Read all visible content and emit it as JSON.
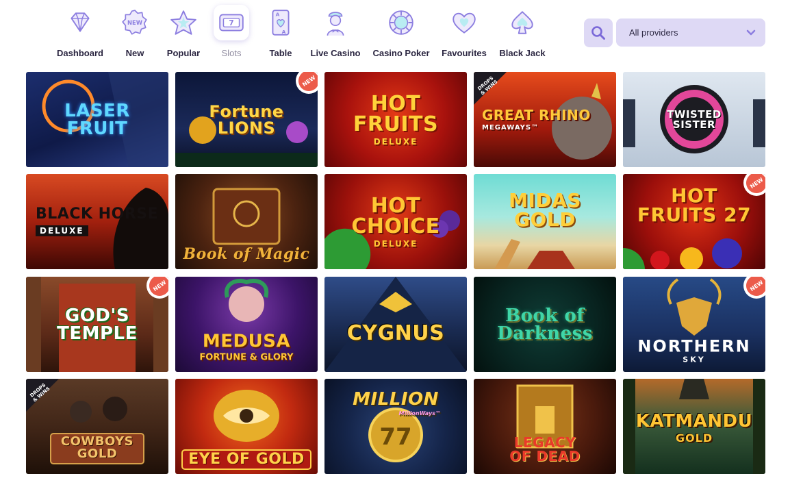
{
  "nav": {
    "items": [
      {
        "label": "Dashboard",
        "icon": "diamond-icon"
      },
      {
        "label": "New",
        "icon": "new-badge-icon"
      },
      {
        "label": "Popular",
        "icon": "star-icon"
      },
      {
        "label": "Slots",
        "icon": "slot-machine-icon",
        "active": true
      },
      {
        "label": "Table",
        "icon": "playing-card-icon"
      },
      {
        "label": "Live Casino",
        "icon": "dealer-icon"
      },
      {
        "label": "Casino Poker",
        "icon": "poker-chip-icon"
      },
      {
        "label": "Favourites",
        "icon": "heart-icon"
      },
      {
        "label": "Black Jack",
        "icon": "spade-icon"
      }
    ]
  },
  "filters": {
    "search_icon": "search-icon",
    "provider": "All providers",
    "provider_icon": "chevron-down-icon"
  },
  "badges": {
    "new": "NEW",
    "drops_wins": "DROPS & WINS"
  },
  "colors": {
    "accent": "#ded9f5",
    "icon_purple": "#8c7ee0",
    "badge_red": "#ec5b4a"
  },
  "games": [
    {
      "title": "LASER FRUIT",
      "subtitle": ""
    },
    {
      "title": "Fortune LIONS",
      "subtitle": "",
      "badge": "new"
    },
    {
      "title": "HOT FRUITS",
      "subtitle": "DELUXE"
    },
    {
      "title": "GREAT RHINO",
      "subtitle": "MEGAWAYS™",
      "badge": "drops"
    },
    {
      "title": "TWISTED SISTER",
      "subtitle": ""
    },
    {
      "title": "BLACK HORSE",
      "subtitle": "DELUXE"
    },
    {
      "title": "Book of Magic",
      "subtitle": ""
    },
    {
      "title": "HOT CHOICE",
      "subtitle": "DELUXE"
    },
    {
      "title": "MIDAS GOLD",
      "subtitle": ""
    },
    {
      "title": "HOT FRUITS 27",
      "subtitle": "",
      "badge": "new"
    },
    {
      "title": "GOD'S TEMPLE",
      "subtitle": "",
      "badge": "new"
    },
    {
      "title": "MEDUSA",
      "subtitle": "FORTUNE & GLORY"
    },
    {
      "title": "CYGNUS",
      "subtitle": ""
    },
    {
      "title": "Book of Darkness",
      "subtitle": ""
    },
    {
      "title": "NORTHERN",
      "subtitle": "SKY",
      "badge": "new"
    },
    {
      "title": "COWBOYS GOLD",
      "subtitle": "",
      "badge": "drops"
    },
    {
      "title": "EYE OF GOLD",
      "subtitle": ""
    },
    {
      "title": "MILLION",
      "subtitle": "MillionWays™"
    },
    {
      "title": "LEGACY OF DEAD",
      "subtitle": ""
    },
    {
      "title": "KATMANDU",
      "subtitle": "GOLD"
    }
  ]
}
